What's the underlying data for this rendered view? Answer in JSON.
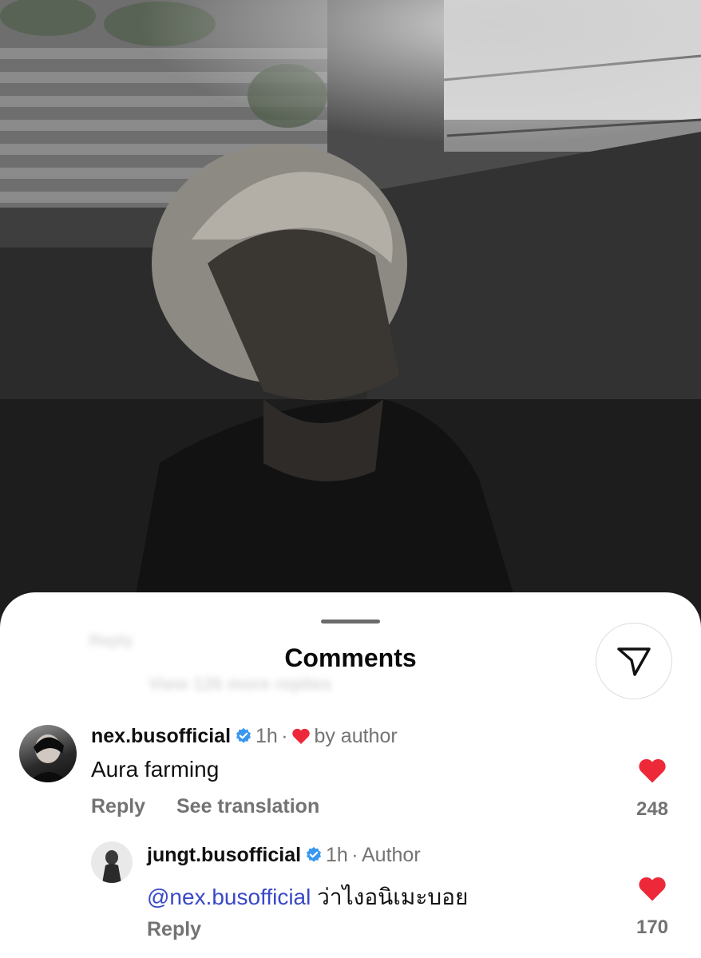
{
  "photo": {
    "description_icon": "photo-post"
  },
  "sheet": {
    "title": "Comments",
    "ghost_reply": "Reply",
    "ghost_more": "View 126 more replies"
  },
  "comments": [
    {
      "username": "nex.busofficial",
      "time": "1h",
      "dot": "·",
      "liked_by_author": "by author",
      "text": "Aura farming",
      "reply_label": "Reply",
      "translate_label": "See translation",
      "likes": "248"
    },
    {
      "username": "jungt.busofficial",
      "time": "1h",
      "dot": "·",
      "badge": "Author",
      "mention": "@nex.busofficial",
      "text": "ว่าไงอนิเมะบอย",
      "reply_label": "Reply",
      "likes": "170"
    }
  ],
  "colors": {
    "verified": "#3897f0",
    "heart": "#ed2939",
    "mention": "#3a48c8"
  }
}
